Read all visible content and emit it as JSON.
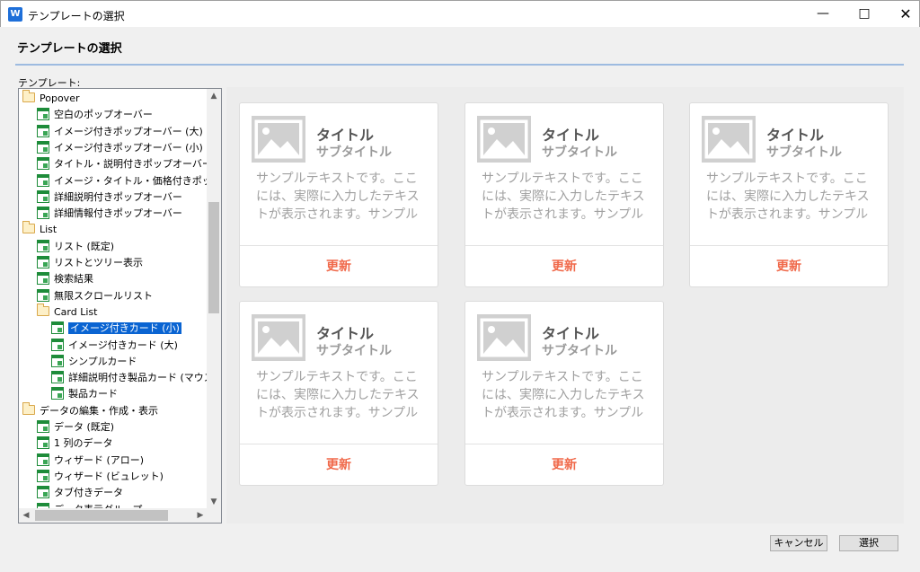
{
  "window": {
    "app_icon": "W",
    "title": "テンプレートの選択",
    "minimize": "—",
    "maximize": "□",
    "close": "✕"
  },
  "dialog": {
    "title": "テンプレートの選択",
    "tree_label": "テンプレート:"
  },
  "tree": {
    "items": [
      {
        "label": "Popover",
        "type": "folder",
        "level": 0
      },
      {
        "label": "空白のポップオーバー",
        "type": "template",
        "level": 1
      },
      {
        "label": "イメージ付きポップオーバー (大)",
        "type": "template",
        "level": 1
      },
      {
        "label": "イメージ付きポップオーバー (小)",
        "type": "template",
        "level": 1
      },
      {
        "label": "タイトル・説明付きポップオーバー",
        "type": "template",
        "level": 1
      },
      {
        "label": "イメージ・タイトル・価格付きポップオーバー",
        "type": "template",
        "level": 1
      },
      {
        "label": "詳細説明付きポップオーバー",
        "type": "template",
        "level": 1
      },
      {
        "label": "詳細情報付きポップオーバー",
        "type": "template",
        "level": 1
      },
      {
        "label": "List",
        "type": "folder",
        "level": 0
      },
      {
        "label": "リスト (既定)",
        "type": "template",
        "level": 1
      },
      {
        "label": "リストとツリー表示",
        "type": "template",
        "level": 1
      },
      {
        "label": "検索結果",
        "type": "template",
        "level": 1
      },
      {
        "label": "無限スクロールリスト",
        "type": "template",
        "level": 1
      },
      {
        "label": "Card List",
        "type": "folder",
        "level": 1
      },
      {
        "label": "イメージ付きカード (小)",
        "type": "template",
        "level": 2,
        "selected": true
      },
      {
        "label": "イメージ付きカード (大)",
        "type": "template",
        "level": 2
      },
      {
        "label": "シンプルカード",
        "type": "template",
        "level": 2
      },
      {
        "label": "詳細説明付き製品カード (マウスオーバー)",
        "type": "template",
        "level": 2
      },
      {
        "label": "製品カード",
        "type": "template",
        "level": 2
      },
      {
        "label": "データの編集・作成・表示",
        "type": "folder",
        "level": 0
      },
      {
        "label": "データ (既定)",
        "type": "template",
        "level": 1
      },
      {
        "label": "1 列のデータ",
        "type": "template",
        "level": 1
      },
      {
        "label": "ウィザード (アロー)",
        "type": "template",
        "level": 1
      },
      {
        "label": "ウィザード (ビュレット)",
        "type": "template",
        "level": 1
      },
      {
        "label": "タブ付きデータ",
        "type": "template",
        "level": 1
      },
      {
        "label": "データ表示グループ",
        "type": "template",
        "level": 1
      }
    ],
    "scroll_up": "▲",
    "scroll_down": "▼",
    "scroll_left": "◀",
    "scroll_right": "▶"
  },
  "preview": {
    "cards": [
      {
        "title": "タイトル",
        "subtitle": "サブタイトル",
        "text": "サンプルテキストです。ここには、実際に入力したテキストが表示されます。サンプル",
        "action": "更新"
      },
      {
        "title": "タイトル",
        "subtitle": "サブタイトル",
        "text": "サンプルテキストです。ここには、実際に入力したテキストが表示されます。サンプル",
        "action": "更新"
      },
      {
        "title": "タイトル",
        "subtitle": "サブタイトル",
        "text": "サンプルテキストです。ここには、実際に入力したテキストが表示されます。サンプル",
        "action": "更新"
      },
      {
        "title": "タイトル",
        "subtitle": "サブタイトル",
        "text": "サンプルテキストです。ここには、実際に入力したテキストが表示されます。サンプル",
        "action": "更新"
      },
      {
        "title": "タイトル",
        "subtitle": "サブタイトル",
        "text": "サンプルテキストです。ここには、実際に入力したテキストが表示されます。サンプル",
        "action": "更新"
      }
    ]
  },
  "buttons": {
    "cancel": "キャンセル",
    "select": "選択"
  },
  "colors": {
    "accent_action": "#f0694a",
    "selection": "#0a64d2",
    "header_rule": "#9dbbe0"
  }
}
